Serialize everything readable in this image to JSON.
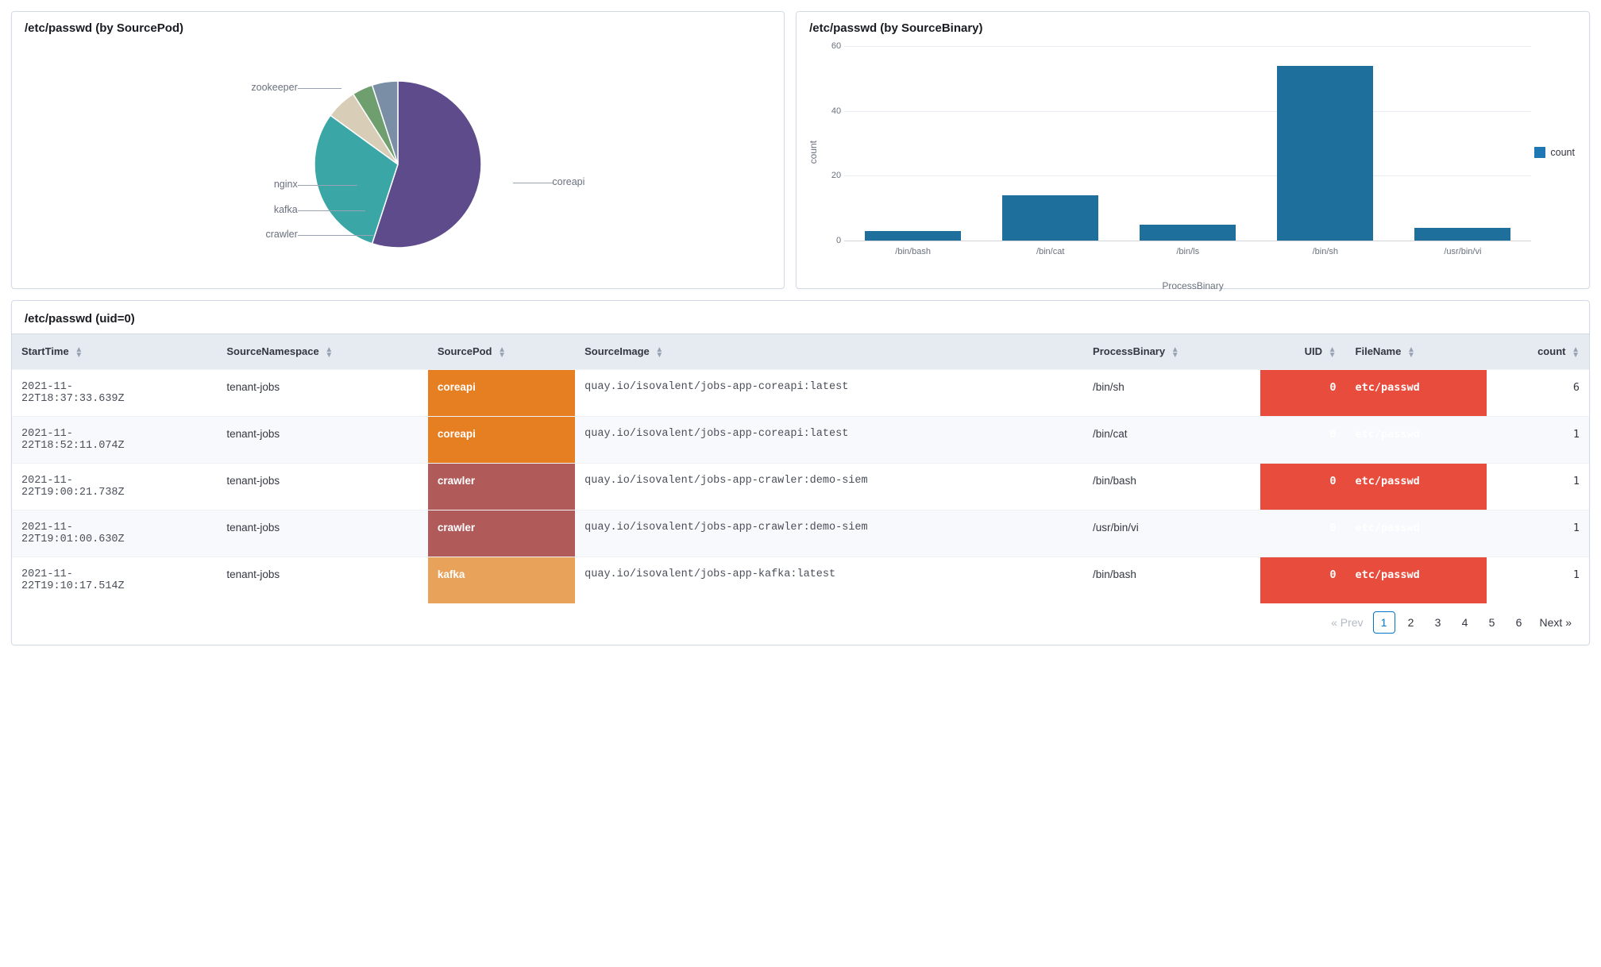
{
  "panels": {
    "pie": {
      "title": "/etc/passwd (by SourcePod)"
    },
    "bar": {
      "title": "/etc/passwd (by SourceBinary)",
      "legend": "count",
      "yLabel": "count",
      "xLabel": "ProcessBinary"
    },
    "table": {
      "title": "/etc/passwd (uid=0)"
    }
  },
  "chart_data": [
    {
      "type": "pie",
      "title": "/etc/passwd (by SourcePod)",
      "series": [
        {
          "name": "coreapi",
          "value": 55,
          "color": "#5e4b8b"
        },
        {
          "name": "zookeeper",
          "value": 30,
          "color": "#3aa6a6"
        },
        {
          "name": "nginx",
          "value": 6,
          "color": "#d8ceb8"
        },
        {
          "name": "kafka",
          "value": 4,
          "color": "#6f9e6f"
        },
        {
          "name": "crawler",
          "value": 5,
          "color": "#7a8fa6"
        }
      ]
    },
    {
      "type": "bar",
      "title": "/etc/passwd (by SourceBinary)",
      "xlabel": "ProcessBinary",
      "ylabel": "count",
      "ylim": [
        0,
        60
      ],
      "yticks": [
        0,
        20,
        40,
        60
      ],
      "categories": [
        "/bin/bash",
        "/bin/cat",
        "/bin/ls",
        "/bin/sh",
        "/usr/bin/vi"
      ],
      "series": [
        {
          "name": "count",
          "values": [
            3,
            14,
            5,
            54,
            4
          ],
          "color": "#1f6f9c"
        }
      ]
    }
  ],
  "table": {
    "columns": [
      {
        "key": "StartTime",
        "label": "StartTime",
        "sortable": true
      },
      {
        "key": "SourceNamespace",
        "label": "SourceNamespace",
        "sortable": true
      },
      {
        "key": "SourcePod",
        "label": "SourcePod",
        "sortable": true
      },
      {
        "key": "SourceImage",
        "label": "SourceImage",
        "sortable": true
      },
      {
        "key": "ProcessBinary",
        "label": "ProcessBinary",
        "sortable": true
      },
      {
        "key": "UID",
        "label": "UID",
        "sortable": true,
        "numeric": true
      },
      {
        "key": "FileName",
        "label": "FileName",
        "sortable": true
      },
      {
        "key": "count",
        "label": "count",
        "sortable": true,
        "numeric": true
      }
    ],
    "rows": [
      {
        "StartTime": "2021-11-22T18:37:33.639Z",
        "SourceNamespace": "tenant-jobs",
        "SourcePod": "coreapi",
        "SourceImage": "quay.io/isovalent/jobs-app-coreapi:latest",
        "ProcessBinary": "/bin/sh",
        "UID": 0,
        "FileName": "etc/passwd",
        "count": 6
      },
      {
        "StartTime": "2021-11-22T18:52:11.074Z",
        "SourceNamespace": "tenant-jobs",
        "SourcePod": "coreapi",
        "SourceImage": "quay.io/isovalent/jobs-app-coreapi:latest",
        "ProcessBinary": "/bin/cat",
        "UID": 0,
        "FileName": "etc/passwd",
        "count": 1
      },
      {
        "StartTime": "2021-11-22T19:00:21.738Z",
        "SourceNamespace": "tenant-jobs",
        "SourcePod": "crawler",
        "SourceImage": "quay.io/isovalent/jobs-app-crawler:demo-siem",
        "ProcessBinary": "/bin/bash",
        "UID": 0,
        "FileName": "etc/passwd",
        "count": 1
      },
      {
        "StartTime": "2021-11-22T19:01:00.630Z",
        "SourceNamespace": "tenant-jobs",
        "SourcePod": "crawler",
        "SourceImage": "quay.io/isovalent/jobs-app-crawler:demo-siem",
        "ProcessBinary": "/usr/bin/vi",
        "UID": 0,
        "FileName": "etc/passwd",
        "count": 1
      },
      {
        "StartTime": "2021-11-22T19:10:17.514Z",
        "SourceNamespace": "tenant-jobs",
        "SourcePod": "kafka",
        "SourceImage": "quay.io/isovalent/jobs-app-kafka:latest",
        "ProcessBinary": "/bin/bash",
        "UID": 0,
        "FileName": "etc/passwd",
        "count": 1
      }
    ]
  },
  "pagination": {
    "prev": "« Prev",
    "next": "Next »",
    "pages": [
      1,
      2,
      3,
      4,
      5,
      6
    ],
    "current": 1
  }
}
